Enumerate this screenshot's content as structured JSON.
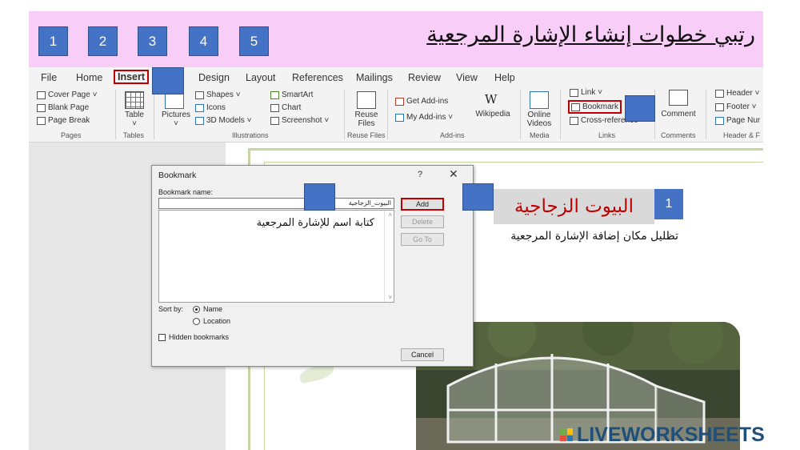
{
  "header": {
    "steps": [
      "1",
      "2",
      "3",
      "4",
      "5"
    ],
    "title": "رتبي خطوات إنشاء الإشارة المرجعية",
    "background": "#f8cdf8",
    "step_color": "#4472c4"
  },
  "ribbon": {
    "tabs": [
      "File",
      "Home",
      "Insert",
      "Design",
      "Layout",
      "References",
      "Mailings",
      "Review",
      "View",
      "Help"
    ],
    "active_tab": "Insert",
    "pages": {
      "cover_page": "Cover Page ˅",
      "blank_page": "Blank Page",
      "page_break": "Page Break",
      "label": "Pages"
    },
    "tables": {
      "table": "Table",
      "label": "Tables"
    },
    "illustrations": {
      "pictures": "Pictures",
      "shapes": "Shapes ˅",
      "icons": "Icons",
      "models": "3D Models ˅",
      "smartart": "SmartArt",
      "chart": "Chart",
      "screenshot": "Screenshot ˅",
      "label": "Illustrations"
    },
    "reuse": {
      "reuse_files_1": "Reuse",
      "reuse_files_2": "Files",
      "label": "Reuse Files"
    },
    "addins": {
      "get": "Get Add-ins",
      "my": "My Add-ins ˅",
      "wikipedia": "Wikipedia",
      "label": "Add-ins"
    },
    "media": {
      "online_1": "Online",
      "online_2": "Videos",
      "label": "Media"
    },
    "links": {
      "link": "Link ˅",
      "bookmark": "Bookmark",
      "cross_reference": "Cross-reference",
      "label": "Links"
    },
    "comments": {
      "comment": "Comment",
      "label": "Comments"
    },
    "header_footer": {
      "header": "Header ˅",
      "footer": "Footer ˅",
      "page_number": "Page Nur",
      "label": "Header & F"
    },
    "highlight_color": "#c00000"
  },
  "dialog": {
    "title": "Bookmark",
    "help": "?",
    "close": "✕",
    "name_label": "Bookmark name:",
    "name_value": "البيوت_الزجاجية",
    "list_note": "كتابة اسم للإشارة المرجعية",
    "buttons": {
      "add": "Add",
      "delete": "Delete",
      "goto": "Go To",
      "cancel": "Cancel"
    },
    "sort_by": "Sort by:",
    "sort_name": "Name",
    "sort_location": "Location",
    "hidden": "Hidden bookmarks"
  },
  "document": {
    "heading": "البيوت الزجاجية",
    "step": "1",
    "caption": "تظليل مكان إضافة الإشارة المرجعية"
  },
  "watermark": {
    "text": "LIVEWORKSHEETS"
  }
}
